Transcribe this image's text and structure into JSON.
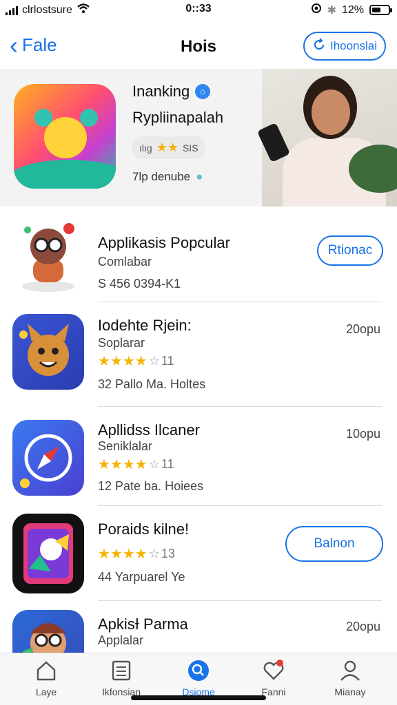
{
  "status": {
    "carrier": "clrlostsure",
    "time": "0::33",
    "battery": "12%"
  },
  "nav": {
    "back_label": "Fale",
    "title": "Hois",
    "action_label": "Ihoonslai"
  },
  "featured": {
    "title": "Inanking",
    "subtitle": "Rypliinapalah",
    "rating_prefix": "ılıg",
    "rating_suffix": "SIS",
    "developer": "7lp denube"
  },
  "apps": [
    {
      "name": "Applikasis Popcular",
      "category": "Comlabar",
      "meta": "S 456 0394-K1",
      "button": "Rtionac"
    },
    {
      "name": "Iodehte Rjein:",
      "category": "Soplarar",
      "stars_count": "11",
      "meta": "32  Pallo Ma.  Holtes",
      "price": "20opu"
    },
    {
      "name": "Apllidss Ilcaner",
      "category": "Seniklalar",
      "stars_count": "11",
      "meta": "12  Pate ba.  Hoiees",
      "price": "10opu"
    },
    {
      "name": "Poraids kilne!",
      "stars_count": "13",
      "meta": "44  Yarpuarel Ye",
      "button": "Balnon"
    },
    {
      "name": "ApkisƗ Parma",
      "category": "Applalar",
      "price": "20opu"
    }
  ],
  "tabs": [
    {
      "label": "Laye",
      "icon": "home-icon"
    },
    {
      "label": "Ikfonsian",
      "icon": "list-icon"
    },
    {
      "label": "Dsiome",
      "icon": "search-icon"
    },
    {
      "label": "Fanni",
      "icon": "heart-icon"
    },
    {
      "label": "Mianay",
      "icon": "person-icon"
    }
  ],
  "colors": {
    "accent": "#1a73e8",
    "star": "#f5b301",
    "badge": "#e53935"
  }
}
